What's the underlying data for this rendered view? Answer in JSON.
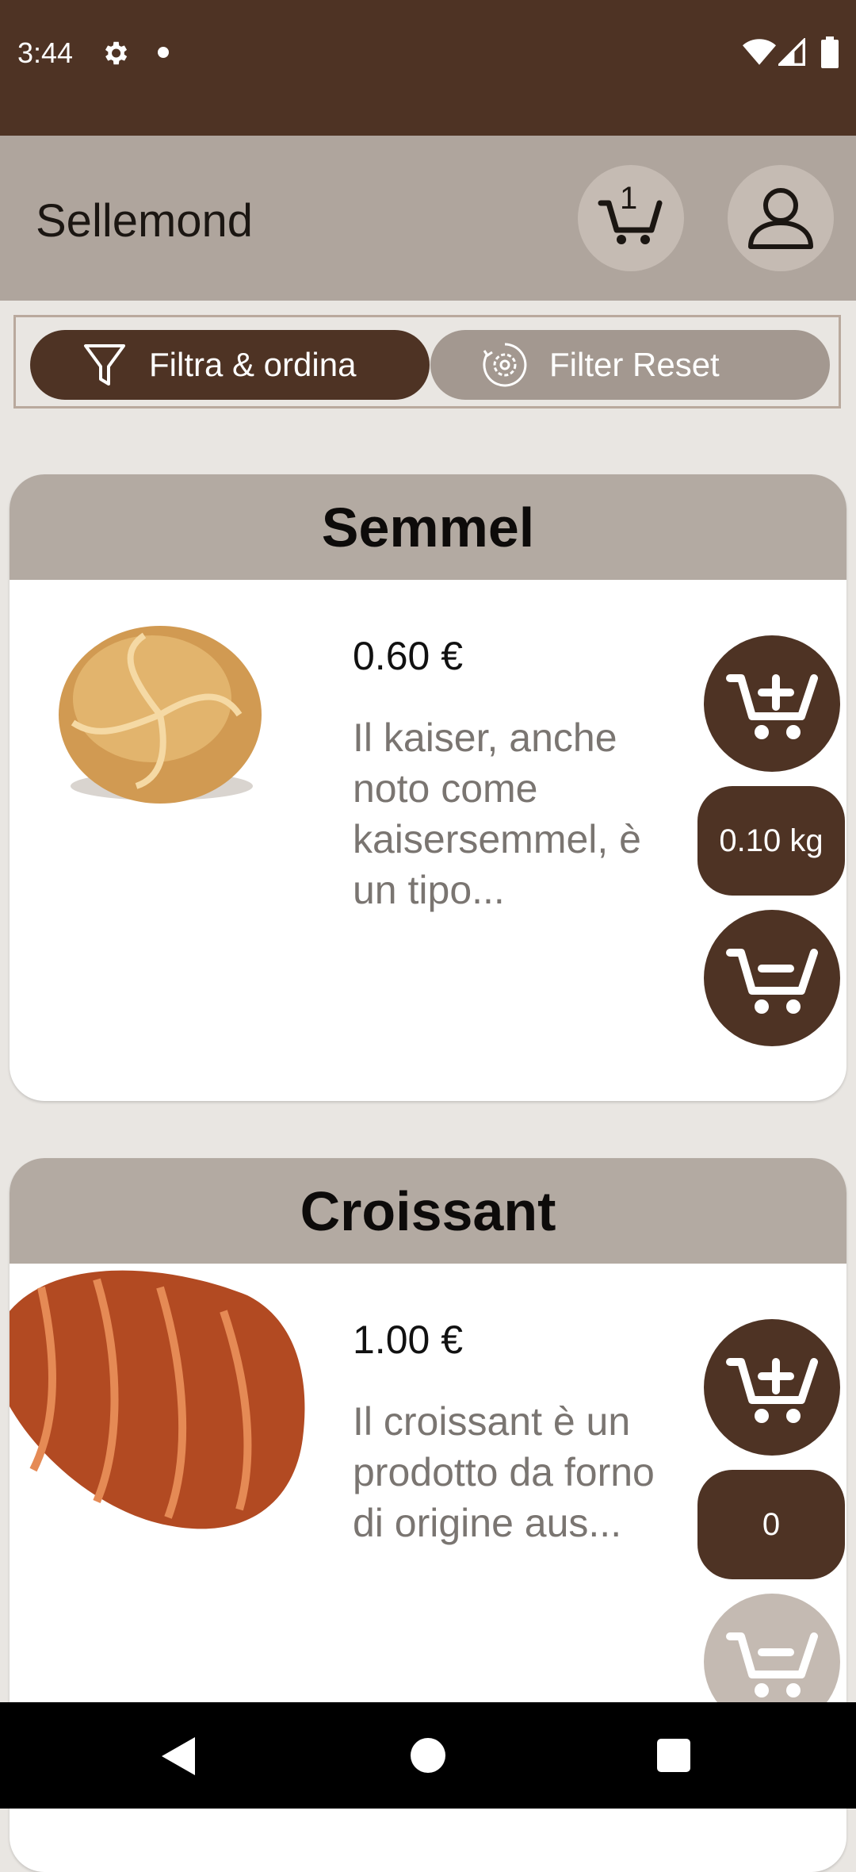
{
  "status_bar": {
    "time": "3:44",
    "icons": [
      "settings-icon",
      "notification-dot",
      "wifi-icon",
      "signal-icon",
      "battery-icon"
    ]
  },
  "app_bar": {
    "title": "Sellemond",
    "cart_count": "1",
    "cart_icon": "cart-icon",
    "profile_icon": "user-icon"
  },
  "filters": {
    "filter_label": "Filtra & ordina",
    "reset_label": "Filter Reset"
  },
  "products": [
    {
      "name": "Semmel",
      "price": "0.60 €",
      "description": "Il kaiser, anche noto come kaisersemmel, è un tipo...",
      "quantity": "0.10 kg",
      "image": "kaiser roll"
    },
    {
      "name": "Croissant",
      "price": "1.00 €",
      "description": "Il croissant è un prodotto da forno di origine aus...",
      "quantity": "0",
      "image": "croissant"
    }
  ],
  "colors": {
    "primary": "#4e3324",
    "header_bg": "#afa59d",
    "card_head": "#b3aaa2",
    "page_bg": "#e9e6e2",
    "disabled": "#c4bab2"
  }
}
